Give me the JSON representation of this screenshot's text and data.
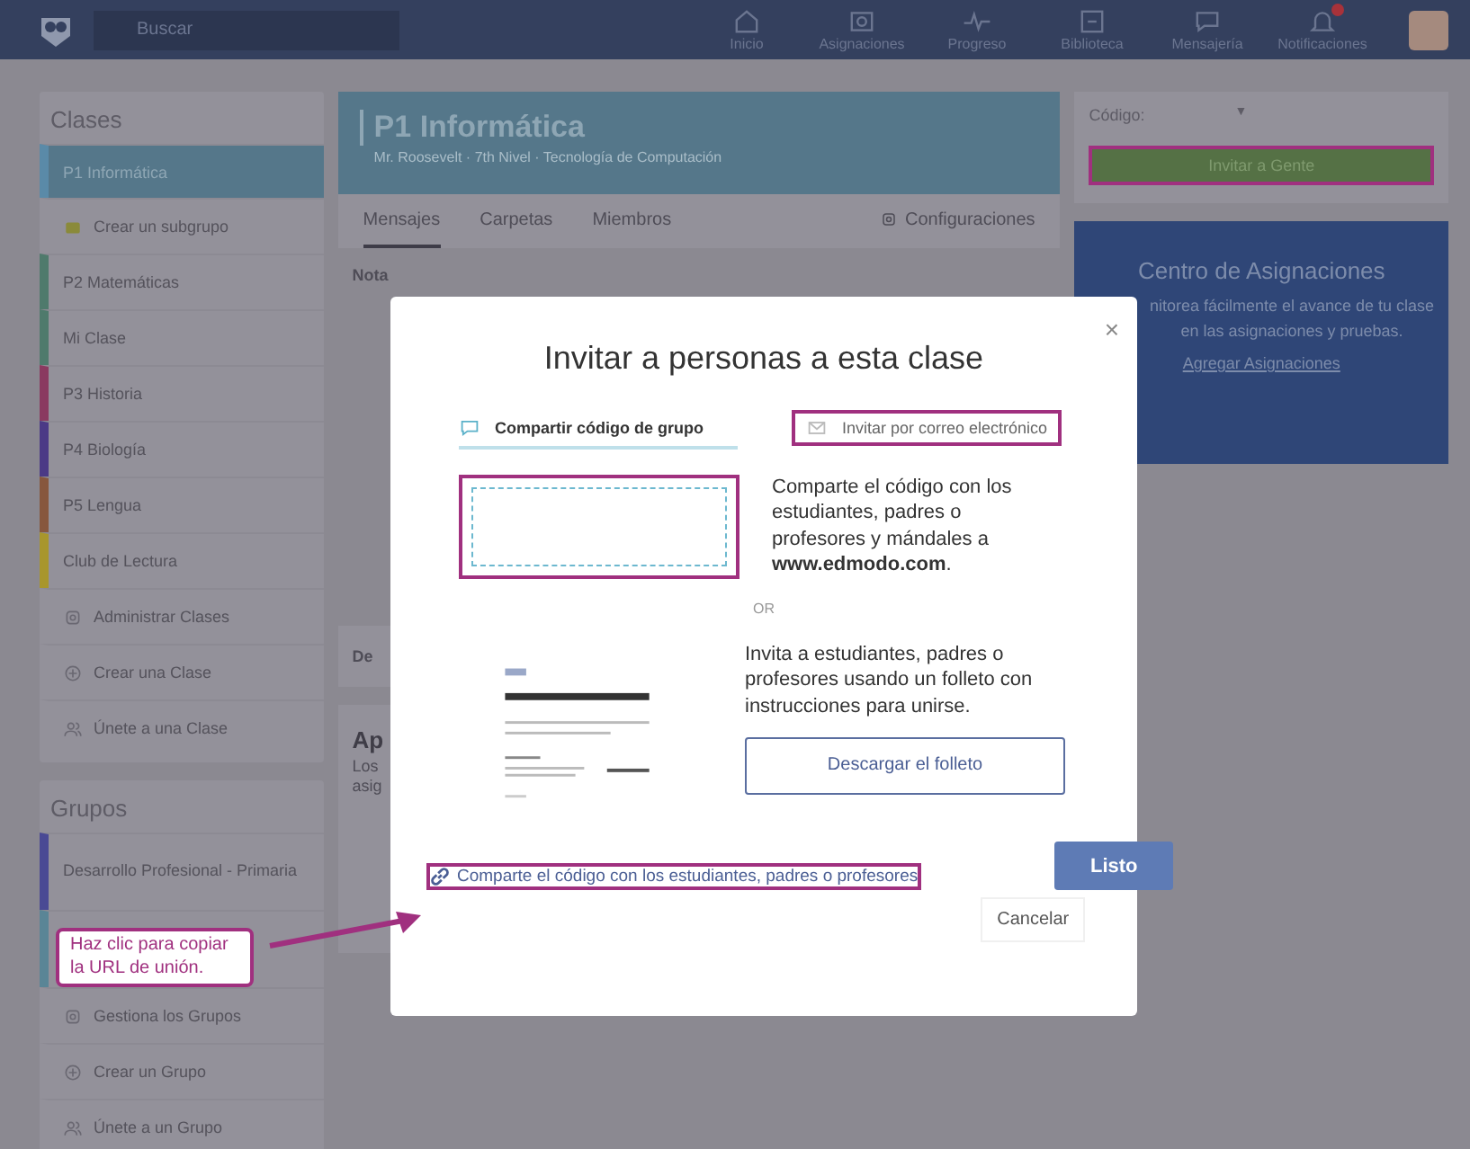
{
  "topbar": {
    "search": {
      "placeholder": "Buscar"
    },
    "nav": [
      {
        "label": "Inicio",
        "badge": false
      },
      {
        "label": "Asignaciones",
        "badge": false
      },
      {
        "label": "Progreso",
        "badge": false
      },
      {
        "label": "Biblioteca",
        "badge": false
      },
      {
        "label": "Mensajería",
        "badge": false
      },
      {
        "label": "Notificaciones",
        "badge": true
      }
    ]
  },
  "classes": {
    "title": "Clases",
    "items": [
      {
        "kind": "class",
        "label": "P1 Informática",
        "selected": true,
        "color": "#5a8aa8"
      },
      {
        "kind": "subgroup",
        "label": "Crear un subgrupo"
      },
      {
        "kind": "class",
        "label": "P2 Matemáticas",
        "selected": false,
        "color": "#4f7a6c"
      },
      {
        "kind": "class",
        "label": "Mi Clase",
        "selected": false,
        "color": "#4f7a6c"
      },
      {
        "kind": "class",
        "label": "P3 Historia",
        "selected": false,
        "color": "#8a3a60"
      },
      {
        "kind": "class",
        "label": "P4 Biología",
        "selected": false,
        "color": "#4b3a86"
      },
      {
        "kind": "class",
        "label": "P5 Lengua",
        "selected": false,
        "color": "#87573e"
      },
      {
        "kind": "class",
        "label": "Club de Lectura",
        "selected": false,
        "color": "#a8962c"
      },
      {
        "kind": "manage",
        "label": "Administrar Clases"
      },
      {
        "kind": "create",
        "label": "Crear una Clase"
      },
      {
        "kind": "join",
        "label": "Únete a una Clase"
      }
    ]
  },
  "groups": {
    "title": "Grupos",
    "items": [
      {
        "kind": "class",
        "label": "Desarrollo Profesional - Primaria",
        "selected": false,
        "color": "#4a4a94"
      },
      {
        "kind": "class",
        "selected": false,
        "color": "#5a8596"
      },
      {
        "kind": "manage",
        "label": "Gestiona los Grupos"
      },
      {
        "kind": "create",
        "label": "Crear un Grupo"
      },
      {
        "kind": "join",
        "label": "Únete a un Grupo"
      }
    ]
  },
  "class_header": {
    "title": "P1 Informática",
    "subtitle": "Mr. Roosevelt · 7th Nivel · Tecnología de Computación"
  },
  "tabs": [
    {
      "label": "Mensajes",
      "selected": true
    },
    {
      "label": "Carpetas",
      "selected": false
    },
    {
      "label": "Miembros",
      "selected": false
    }
  ],
  "settings": "Configuraciones",
  "feed_fragments": {
    "note": "Nota",
    "section": "De",
    "card_title": "Ap",
    "card_text": [
      "Los",
      "asig"
    ]
  },
  "code_panel": {
    "label": "Código:",
    "caret": "▼",
    "button": {
      "label": "Invitar a Gente",
      "highlighted": true
    }
  },
  "assignments_card": {
    "title": "Centro de Asignaciones",
    "text": "nitorea fácilmente el avance de tu clase en las asignaciones y pruebas.",
    "link": "Agregar Asignaciones"
  },
  "modal": {
    "close": "×",
    "title": "Invitar a personas a esta clase",
    "tabs": [
      {
        "label": "Compartir código de grupo",
        "selected": true,
        "highlighted": false
      },
      {
        "label": "Invitar por correo electrónico",
        "selected": false,
        "highlighted": true
      }
    ],
    "code_box": {
      "highlighted": true
    },
    "code_text": "Comparte el código con los estudiantes, padres o profesores y mándales a **www.edmodo.com**.",
    "divider": "OR",
    "flyer_text": "Invita a estudiantes, padres o profesores usando un folleto con instrucciones para unirse.",
    "flyer_button": "Descargar el folleto",
    "share_link": {
      "label": "Comparte el código con los estudiantes, padres o profesores",
      "highlighted": true
    },
    "primary": "Listo",
    "cancel": "Cancelar"
  },
  "callout": "Haz clic para copiar la URL de unión."
}
